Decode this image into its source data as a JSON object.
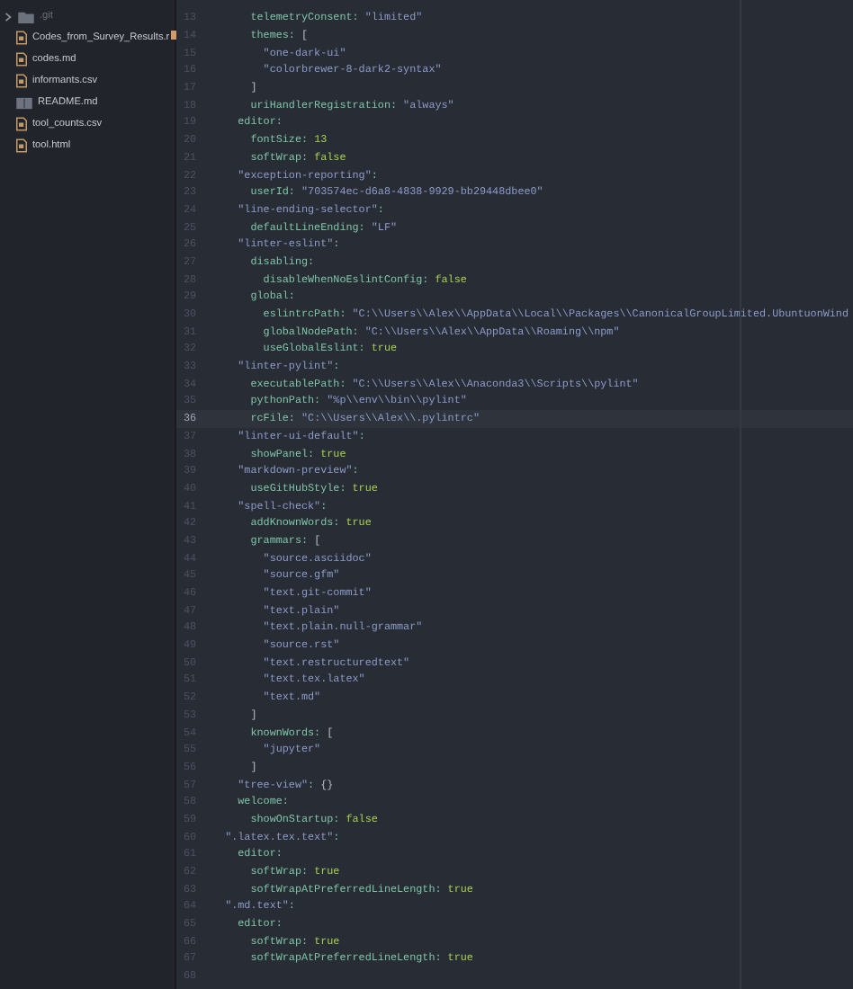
{
  "tree_view": {
    "items": [
      {
        "kind": "folder",
        "name": ".git",
        "expanded": false
      },
      {
        "kind": "file",
        "name": "Codes_from_Survey_Results.r"
      },
      {
        "kind": "file",
        "name": "codes.md"
      },
      {
        "kind": "file",
        "name": "informants.csv"
      },
      {
        "kind": "readme",
        "name": "README.md"
      },
      {
        "kind": "file",
        "name": "tool_counts.csv"
      },
      {
        "kind": "file",
        "name": "tool.html"
      }
    ]
  },
  "editor": {
    "lines": [
      {
        "number": "13",
        "selected": false,
        "changed": false,
        "tokens": [
          {
            "kind": "key",
            "text": "      telemetryConsent:"
          },
          {
            "kind": "string",
            "text": " \"limited\""
          }
        ]
      },
      {
        "number": "14",
        "selected": false,
        "changed": true,
        "tokens": [
          {
            "kind": "key",
            "text": "      themes:"
          },
          {
            "kind": "punct",
            "text": " ["
          }
        ]
      },
      {
        "number": "15",
        "selected": false,
        "changed": false,
        "tokens": [
          {
            "kind": "string",
            "text": "        \"one-dark-ui\""
          }
        ]
      },
      {
        "number": "16",
        "selected": false,
        "changed": false,
        "tokens": [
          {
            "kind": "string",
            "text": "        \"colorbrewer-8-dark2-syntax\""
          }
        ]
      },
      {
        "number": "17",
        "selected": false,
        "changed": false,
        "tokens": [
          {
            "kind": "punct",
            "text": "      ]"
          }
        ]
      },
      {
        "number": "18",
        "selected": false,
        "changed": false,
        "tokens": [
          {
            "kind": "key",
            "text": "      uriHandlerRegistration:"
          },
          {
            "kind": "string",
            "text": " \"always\""
          }
        ]
      },
      {
        "number": "19",
        "selected": false,
        "changed": false,
        "tokens": [
          {
            "kind": "key",
            "text": "    editor:"
          }
        ]
      },
      {
        "number": "20",
        "selected": false,
        "changed": false,
        "tokens": [
          {
            "kind": "key",
            "text": "      fontSize:"
          },
          {
            "kind": "number",
            "text": " 13"
          }
        ]
      },
      {
        "number": "21",
        "selected": false,
        "changed": false,
        "tokens": [
          {
            "kind": "key",
            "text": "      softWrap:"
          },
          {
            "kind": "bool",
            "text": " false"
          }
        ]
      },
      {
        "number": "22",
        "selected": false,
        "changed": false,
        "tokens": [
          {
            "kind": "string",
            "text": "    \"exception-reporting\""
          },
          {
            "kind": "key",
            "text": ":"
          }
        ]
      },
      {
        "number": "23",
        "selected": false,
        "changed": false,
        "tokens": [
          {
            "kind": "key",
            "text": "      userId:"
          },
          {
            "kind": "string",
            "text": " \"703574ec-d6a8-4838-9929-bb29448dbee0\""
          }
        ]
      },
      {
        "number": "24",
        "selected": false,
        "changed": false,
        "tokens": [
          {
            "kind": "string",
            "text": "    \"line-ending-selector\""
          },
          {
            "kind": "key",
            "text": ":"
          }
        ]
      },
      {
        "number": "25",
        "selected": false,
        "changed": false,
        "tokens": [
          {
            "kind": "key",
            "text": "      defaultLineEnding:"
          },
          {
            "kind": "string",
            "text": " \"LF\""
          }
        ]
      },
      {
        "number": "26",
        "selected": false,
        "changed": false,
        "tokens": [
          {
            "kind": "string",
            "text": "    \"linter-eslint\""
          },
          {
            "kind": "key",
            "text": ":"
          }
        ]
      },
      {
        "number": "27",
        "selected": false,
        "changed": false,
        "tokens": [
          {
            "kind": "key",
            "text": "      disabling:"
          }
        ]
      },
      {
        "number": "28",
        "selected": false,
        "changed": false,
        "tokens": [
          {
            "kind": "key",
            "text": "        disableWhenNoEslintConfig:"
          },
          {
            "kind": "bool",
            "text": " false"
          }
        ]
      },
      {
        "number": "29",
        "selected": false,
        "changed": false,
        "tokens": [
          {
            "kind": "key",
            "text": "      global:"
          }
        ]
      },
      {
        "number": "30",
        "selected": false,
        "changed": false,
        "tokens": [
          {
            "kind": "key",
            "text": "        eslintrcPath:"
          },
          {
            "kind": "string",
            "text": " \"C:\\\\Users\\\\Alex\\\\AppData\\\\Local\\\\Packages\\\\CanonicalGroupLimited.UbuntuonWind"
          }
        ]
      },
      {
        "number": "31",
        "selected": false,
        "changed": false,
        "tokens": [
          {
            "kind": "key",
            "text": "        globalNodePath:"
          },
          {
            "kind": "string",
            "text": " \"C:\\\\Users\\\\Alex\\\\AppData\\\\Roaming\\\\npm\""
          }
        ]
      },
      {
        "number": "32",
        "selected": false,
        "changed": false,
        "tokens": [
          {
            "kind": "key",
            "text": "        useGlobalEslint:"
          },
          {
            "kind": "bool",
            "text": " true"
          }
        ]
      },
      {
        "number": "33",
        "selected": false,
        "changed": false,
        "tokens": [
          {
            "kind": "string",
            "text": "    \"linter-pylint\""
          },
          {
            "kind": "key",
            "text": ":"
          }
        ]
      },
      {
        "number": "34",
        "selected": false,
        "changed": false,
        "tokens": [
          {
            "kind": "key",
            "text": "      executablePath:"
          },
          {
            "kind": "string",
            "text": " \"C:\\\\Users\\\\Alex\\\\Anaconda3\\\\Scripts\\\\pylint\""
          }
        ]
      },
      {
        "number": "35",
        "selected": false,
        "changed": false,
        "tokens": [
          {
            "kind": "key",
            "text": "      pythonPath:"
          },
          {
            "kind": "string",
            "text": " \"%p\\\\env\\\\bin\\\\pylint\""
          }
        ]
      },
      {
        "number": "36",
        "selected": true,
        "changed": false,
        "tokens": [
          {
            "kind": "key",
            "text": "      rcFile:"
          },
          {
            "kind": "string",
            "text": " \"C:\\\\Users\\\\Alex\\\\.pylintrc\""
          }
        ]
      },
      {
        "number": "37",
        "selected": false,
        "changed": false,
        "tokens": [
          {
            "kind": "string",
            "text": "    \"linter-ui-default\""
          },
          {
            "kind": "key",
            "text": ":"
          }
        ]
      },
      {
        "number": "38",
        "selected": false,
        "changed": false,
        "tokens": [
          {
            "kind": "key",
            "text": "      showPanel:"
          },
          {
            "kind": "bool",
            "text": " true"
          }
        ]
      },
      {
        "number": "39",
        "selected": false,
        "changed": false,
        "tokens": [
          {
            "kind": "string",
            "text": "    \"markdown-preview\""
          },
          {
            "kind": "key",
            "text": ":"
          }
        ]
      },
      {
        "number": "40",
        "selected": false,
        "changed": false,
        "tokens": [
          {
            "kind": "key",
            "text": "      useGitHubStyle:"
          },
          {
            "kind": "bool",
            "text": " true"
          }
        ]
      },
      {
        "number": "41",
        "selected": false,
        "changed": false,
        "tokens": [
          {
            "kind": "string",
            "text": "    \"spell-check\""
          },
          {
            "kind": "key",
            "text": ":"
          }
        ]
      },
      {
        "number": "42",
        "selected": false,
        "changed": false,
        "tokens": [
          {
            "kind": "key",
            "text": "      addKnownWords:"
          },
          {
            "kind": "bool",
            "text": " true"
          }
        ]
      },
      {
        "number": "43",
        "selected": false,
        "changed": false,
        "tokens": [
          {
            "kind": "key",
            "text": "      grammars:"
          },
          {
            "kind": "punct",
            "text": " ["
          }
        ]
      },
      {
        "number": "44",
        "selected": false,
        "changed": false,
        "tokens": [
          {
            "kind": "string",
            "text": "        \"source.asciidoc\""
          }
        ]
      },
      {
        "number": "45",
        "selected": false,
        "changed": false,
        "tokens": [
          {
            "kind": "string",
            "text": "        \"source.gfm\""
          }
        ]
      },
      {
        "number": "46",
        "selected": false,
        "changed": false,
        "tokens": [
          {
            "kind": "string",
            "text": "        \"text.git-commit\""
          }
        ]
      },
      {
        "number": "47",
        "selected": false,
        "changed": false,
        "tokens": [
          {
            "kind": "string",
            "text": "        \"text.plain\""
          }
        ]
      },
      {
        "number": "48",
        "selected": false,
        "changed": false,
        "tokens": [
          {
            "kind": "string",
            "text": "        \"text.plain.null-grammar\""
          }
        ]
      },
      {
        "number": "49",
        "selected": false,
        "changed": false,
        "tokens": [
          {
            "kind": "string",
            "text": "        \"source.rst\""
          }
        ]
      },
      {
        "number": "50",
        "selected": false,
        "changed": false,
        "tokens": [
          {
            "kind": "string",
            "text": "        \"text.restructuredtext\""
          }
        ]
      },
      {
        "number": "51",
        "selected": false,
        "changed": false,
        "tokens": [
          {
            "kind": "string",
            "text": "        \"text.tex.latex\""
          }
        ]
      },
      {
        "number": "52",
        "selected": false,
        "changed": false,
        "tokens": [
          {
            "kind": "string",
            "text": "        \"text.md\""
          }
        ]
      },
      {
        "number": "53",
        "selected": false,
        "changed": false,
        "tokens": [
          {
            "kind": "punct",
            "text": "      ]"
          }
        ]
      },
      {
        "number": "54",
        "selected": false,
        "changed": false,
        "tokens": [
          {
            "kind": "key",
            "text": "      knownWords:"
          },
          {
            "kind": "punct",
            "text": " ["
          }
        ]
      },
      {
        "number": "55",
        "selected": false,
        "changed": false,
        "tokens": [
          {
            "kind": "string",
            "text": "        \"jupyter\""
          }
        ]
      },
      {
        "number": "56",
        "selected": false,
        "changed": false,
        "tokens": [
          {
            "kind": "punct",
            "text": "      ]"
          }
        ]
      },
      {
        "number": "57",
        "selected": false,
        "changed": false,
        "tokens": [
          {
            "kind": "string",
            "text": "    \"tree-view\""
          },
          {
            "kind": "key",
            "text": ":"
          },
          {
            "kind": "punct",
            "text": " {}"
          }
        ]
      },
      {
        "number": "58",
        "selected": false,
        "changed": false,
        "tokens": [
          {
            "kind": "key",
            "text": "    welcome:"
          }
        ]
      },
      {
        "number": "59",
        "selected": false,
        "changed": false,
        "tokens": [
          {
            "kind": "key",
            "text": "      showOnStartup:"
          },
          {
            "kind": "bool",
            "text": " false"
          }
        ]
      },
      {
        "number": "60",
        "selected": false,
        "changed": false,
        "tokens": [
          {
            "kind": "string",
            "text": "  \".latex.tex.text\""
          },
          {
            "kind": "key",
            "text": ":"
          }
        ]
      },
      {
        "number": "61",
        "selected": false,
        "changed": false,
        "tokens": [
          {
            "kind": "key",
            "text": "    editor:"
          }
        ]
      },
      {
        "number": "62",
        "selected": false,
        "changed": false,
        "tokens": [
          {
            "kind": "key",
            "text": "      softWrap:"
          },
          {
            "kind": "bool",
            "text": " true"
          }
        ]
      },
      {
        "number": "63",
        "selected": false,
        "changed": false,
        "tokens": [
          {
            "kind": "key",
            "text": "      softWrapAtPreferredLineLength:"
          },
          {
            "kind": "bool",
            "text": " true"
          }
        ]
      },
      {
        "number": "64",
        "selected": false,
        "changed": false,
        "tokens": [
          {
            "kind": "string",
            "text": "  \".md.text\""
          },
          {
            "kind": "key",
            "text": ":"
          }
        ]
      },
      {
        "number": "65",
        "selected": false,
        "changed": false,
        "tokens": [
          {
            "kind": "key",
            "text": "    editor:"
          }
        ]
      },
      {
        "number": "66",
        "selected": false,
        "changed": false,
        "tokens": [
          {
            "kind": "key",
            "text": "      softWrap:"
          },
          {
            "kind": "bool",
            "text": " true"
          }
        ]
      },
      {
        "number": "67",
        "selected": false,
        "changed": false,
        "tokens": [
          {
            "kind": "key",
            "text": "      softWrapAtPreferredLineLength:"
          },
          {
            "kind": "bool",
            "text": " true"
          }
        ]
      },
      {
        "number": "68",
        "selected": false,
        "changed": false
      }
    ]
  }
}
